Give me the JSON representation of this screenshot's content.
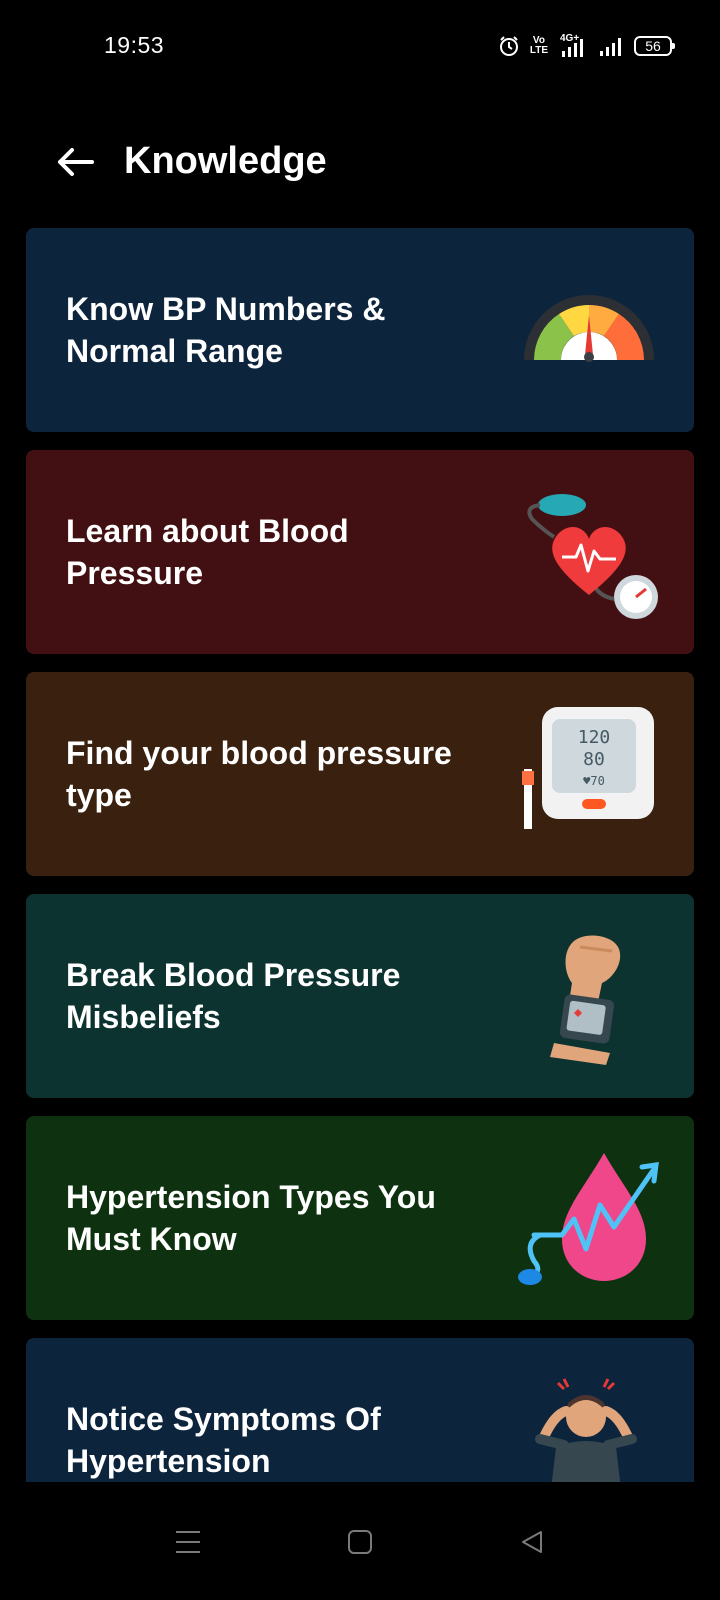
{
  "status_bar": {
    "time": "19:53",
    "volte_label": "Vo\nLTE",
    "network_label": "4G+",
    "battery_level": "56"
  },
  "header": {
    "title": "Knowledge",
    "back_icon": "arrow-left-icon"
  },
  "cards": [
    {
      "title": "Know BP Numbers & Normal Range",
      "icon": "bp-gauge-icon",
      "bg": "#0d243d"
    },
    {
      "title": "Learn about Blood Pressure",
      "icon": "heart-sphygmomanometer-icon",
      "bg": "#421012"
    },
    {
      "title": "Find your blood pressure type",
      "icon": "bp-monitor-icon",
      "monitor_readings": [
        "120",
        "80",
        "♥70"
      ],
      "bg": "#3a200f"
    },
    {
      "title": "Break Blood Pressure Misbeliefs",
      "icon": "wrist-monitor-icon",
      "bg": "#0c3330"
    },
    {
      "title": "Hypertension Types You Must Know",
      "icon": "blood-drop-chart-icon",
      "bg": "#0e3210"
    },
    {
      "title": "Notice Symptoms Of Hypertension",
      "icon": "headache-person-icon",
      "bg": "#0d243d"
    }
  ],
  "nav_bar": {
    "menu_icon": "menu-icon",
    "home_icon": "home-square-icon",
    "back_icon": "back-triangle-icon"
  }
}
